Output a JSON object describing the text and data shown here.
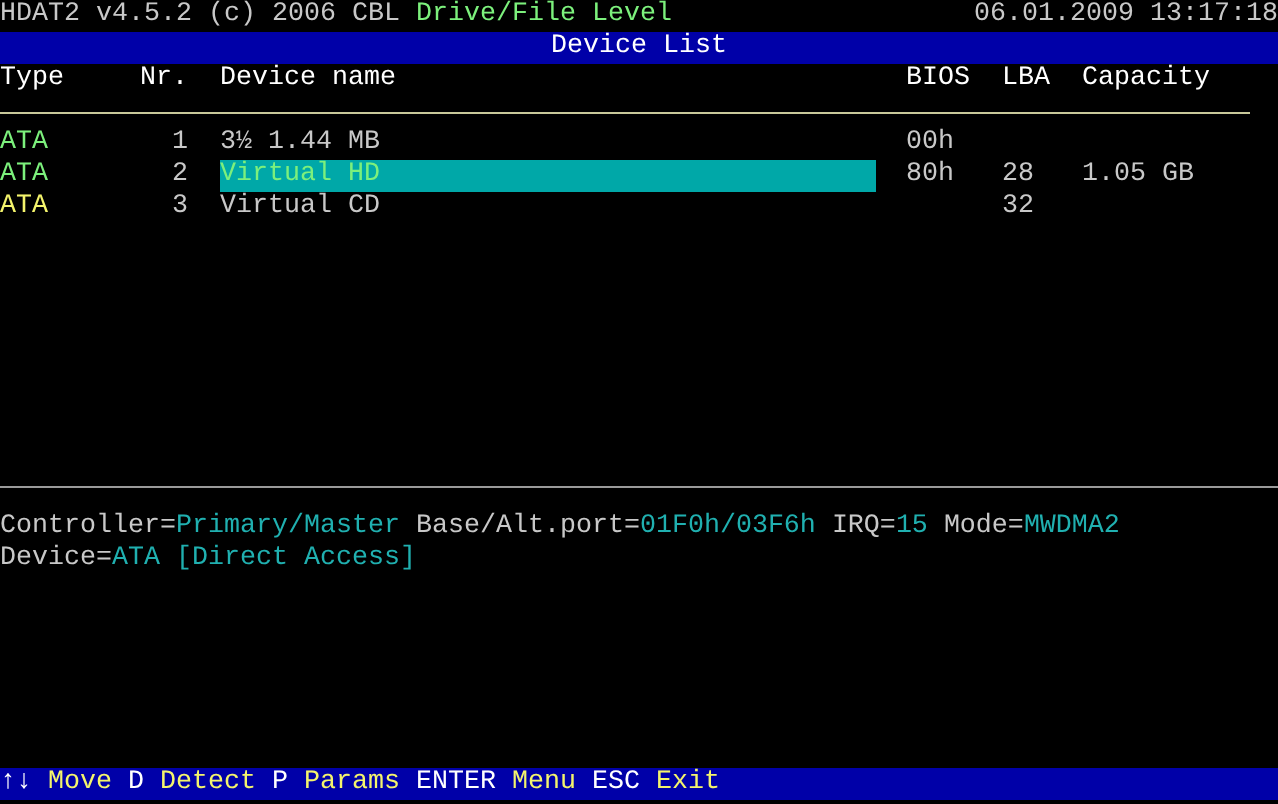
{
  "header": {
    "program": "HDAT2 v4.5.2 (c) 2006 CBL",
    "level": "Drive/File Level",
    "datetime": "06.01.2009 13:17:18"
  },
  "panel_title": "Device List",
  "table": {
    "columns": [
      "Type",
      "Nr.",
      "Device name",
      "BIOS",
      "LBA",
      "Capacity"
    ],
    "rows": [
      {
        "type": "ATA",
        "color": "#7cf07c",
        "nr": "1",
        "name": "3½ 1.44 MB",
        "bios": "00h",
        "selected": false
      },
      {
        "type": "ATA",
        "color": "#7cf07c",
        "nr": "2",
        "name": "Virtual HD",
        "bios": "80h",
        "lba": "28",
        "capacity": "1.05 GB",
        "selected": true
      },
      {
        "type": "ATA",
        "color": "#f4f46c",
        "nr": "3",
        "name": "Virtual CD",
        "lba": "32",
        "selected": false
      }
    ]
  },
  "info": [
    [
      {
        "label": "Controller=",
        "value": "Primary/Master"
      },
      {
        "label": "Base/Alt.port=",
        "value": "01F0h/03F6h"
      },
      {
        "label": "IRQ=",
        "value": "15"
      },
      {
        "label": "Mode=",
        "value": "MWDMA2"
      }
    ],
    [
      {
        "label": "Device=",
        "value": "ATA [Direct Access]"
      }
    ]
  ],
  "status_bar": [
    {
      "key": "↑↓",
      "action": "Move"
    },
    {
      "key": "D",
      "action": "Detect"
    },
    {
      "key": "P",
      "action": "Params"
    },
    {
      "key": "ENTER",
      "action": "Menu"
    },
    {
      "key": "ESC",
      "action": "Exit"
    }
  ]
}
